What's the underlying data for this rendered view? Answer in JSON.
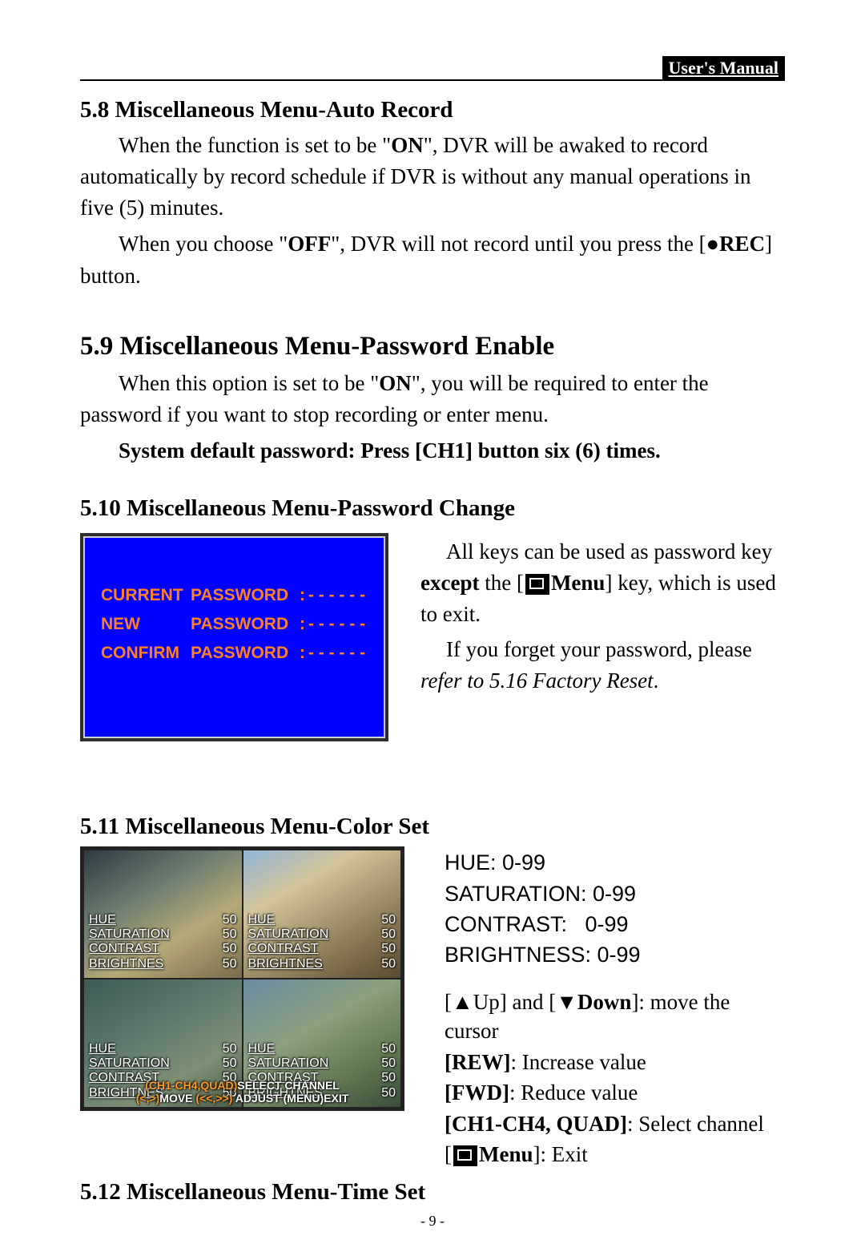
{
  "header": {
    "tag": "User's Manual"
  },
  "sec_5_8": {
    "title": "5.8 Miscellaneous Menu-Auto Record",
    "p1a": "When the function is set to be \"",
    "p1_on": "ON",
    "p1b": "\", DVR will be awaked to record automatically by record schedule if DVR is without any manual operations in five (5) minutes.",
    "p2a": "When you choose \"",
    "p2_off": "OFF",
    "p2b": "\", DVR will not record until you press the [",
    "p2_rec": "●REC",
    "p2c": "] button."
  },
  "sec_5_9": {
    "title": "5.9 Miscellaneous Menu-Password Enable",
    "p1a": "When this option is set to be \"",
    "p1_on": "ON",
    "p1b": "\", you will be required to enter the password if you want to stop recording or enter menu.",
    "p2": "System default password: Press [CH1] button six (6) times."
  },
  "sec_5_10": {
    "title": "5.10 Miscellaneous Menu-Password Change",
    "box": {
      "rows": [
        {
          "k1": "CURRENT",
          "k2": "PASSWORD",
          "val": "- - - - - -"
        },
        {
          "k1": "NEW",
          "k2": "PASSWORD",
          "val": "- - - - - -"
        },
        {
          "k1": "CONFIRM",
          "k2": "PASSWORD",
          "val": "- - - - - -"
        }
      ]
    },
    "side": {
      "l1": "All keys can be used as password key ",
      "except": "except",
      "l1b": " the [",
      "menu": "Menu",
      "l1c": "] key, which is used to exit.",
      "l2": "If you forget your password, please ",
      "ref": "refer to 5.16 Factory Reset",
      "l2b": "."
    }
  },
  "sec_5_11": {
    "title": "5.11 Miscellaneous Menu-Color Set",
    "quad_labels": [
      "HUE",
      "SATURATION",
      "CONTRAST",
      "BRIGHTNES"
    ],
    "quad_value": "50",
    "hint1a": "(CH1-CH4,QUAD)",
    "hint1b": "SELECT CHANNEL",
    "hint2a": "(<,>)",
    "hint2b": "MOVE ",
    "hint2c": "(<<,>>) ",
    "hint2d": "ADJUST (MENU)EXIT",
    "ranges": {
      "hue": "HUE: 0-99",
      "sat": "SATURATION: 0-99",
      "con": "CONTRAST:   0-99",
      "bri": "BRIGHTNESS: 0-99"
    },
    "ctrl": {
      "l1a": "[▲Up",
      "l1b": "] and [",
      "l1c": "▼Down",
      "l1d": "]: move the cursor",
      "l2a": "[REW]",
      "l2b": ": Increase value",
      "l3a": "[FWD]",
      "l3b": ": Reduce value",
      "l4a": "[CH1-CH4, QUAD]",
      "l4b": ": Select channel",
      "l5a": "[",
      "l5b": "Menu",
      "l5c": "]: Exit"
    }
  },
  "sec_5_12": {
    "title": "5.12 Miscellaneous Menu-Time Set"
  },
  "page_number": "- 9 -"
}
